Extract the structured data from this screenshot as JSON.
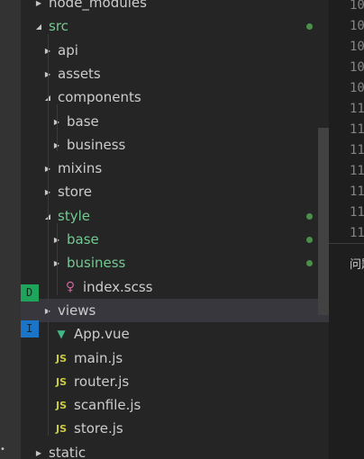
{
  "tree": [
    {
      "label": "node_modules",
      "twist": "right",
      "icon": "",
      "indent": 0,
      "git": false
    },
    {
      "label": "src",
      "twist": "down",
      "icon": "",
      "indent": 0,
      "git": true,
      "dot": true
    },
    {
      "label": "api",
      "twist": "right",
      "icon": "",
      "indent": 1
    },
    {
      "label": "assets",
      "twist": "right",
      "icon": "",
      "indent": 1
    },
    {
      "label": "components",
      "twist": "down",
      "icon": "",
      "indent": 1
    },
    {
      "label": "base",
      "twist": "right",
      "icon": "",
      "indent": 2
    },
    {
      "label": "business",
      "twist": "right",
      "icon": "",
      "indent": 2
    },
    {
      "label": "mixins",
      "twist": "right",
      "icon": "",
      "indent": 1
    },
    {
      "label": "store",
      "twist": "right",
      "icon": "",
      "indent": 1
    },
    {
      "label": "style",
      "twist": "down",
      "icon": "",
      "indent": 1,
      "git": true,
      "dot": true
    },
    {
      "label": "base",
      "twist": "right",
      "icon": "",
      "indent": 2,
      "git": true,
      "dot": true
    },
    {
      "label": "business",
      "twist": "right",
      "icon": "",
      "indent": 2,
      "git": true,
      "dot": true
    },
    {
      "label": "index.scss",
      "twist": "",
      "icon": "sass-icon",
      "indent": 2
    },
    {
      "label": "views",
      "twist": "right",
      "icon": "",
      "indent": 1,
      "selected": true
    },
    {
      "label": "App.vue",
      "twist": "",
      "icon": "vue-icon",
      "indent": 1
    },
    {
      "label": "main.js",
      "twist": "",
      "icon": "js-icon",
      "indent": 1
    },
    {
      "label": "router.js",
      "twist": "",
      "icon": "js-icon",
      "indent": 1
    },
    {
      "label": "scanfile.js",
      "twist": "",
      "icon": "js-icon",
      "indent": 1
    },
    {
      "label": "store.js",
      "twist": "",
      "icon": "js-icon",
      "indent": 1
    },
    {
      "label": "static",
      "twist": "right",
      "icon": "",
      "indent": 0
    }
  ],
  "icons": {
    "js": "JS",
    "vue_color": "#41b883",
    "sass_color": "#cd6799",
    "js_color": "#cbcb41",
    "git_color": "#73c991",
    "dot_color": "#4b8f4b"
  },
  "editor": {
    "line_numbers": [
      "10",
      "10",
      "10",
      "10",
      "10",
      "11",
      "11",
      "11",
      "11",
      "11",
      "11",
      "11"
    ]
  },
  "panel": {
    "title": "问题",
    "badge_green": "D",
    "badge_blue": "I"
  }
}
